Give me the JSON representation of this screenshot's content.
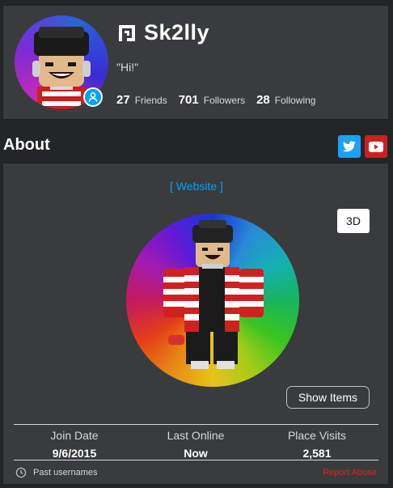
{
  "profile": {
    "username": "Sk2lly",
    "status": "\"Hi!\"",
    "friends_count": "27",
    "friends_label": "Friends",
    "followers_count": "701",
    "followers_label": "Followers",
    "following_count": "28",
    "following_label": "Following"
  },
  "about": {
    "title": "About",
    "website_label": "[ Website ]",
    "button_3d": "3D",
    "show_items": "Show Items",
    "stats": [
      {
        "label": "Join Date",
        "value": "9/6/2015"
      },
      {
        "label": "Last Online",
        "value": "Now"
      },
      {
        "label": "Place Visits",
        "value": "2,581"
      }
    ],
    "past_usernames": "Past usernames",
    "report_abuse": "Report Abuse"
  },
  "icons": {
    "premium": "premium-icon",
    "avatar_badge": "person-icon",
    "twitter": "twitter-icon",
    "youtube": "youtube-icon",
    "history": "clock-icon"
  },
  "colors": {
    "background": "#232527",
    "card": "#393b3d",
    "link": "#00a2ff",
    "twitter": "#1da1f2",
    "youtube": "#cc2121",
    "report": "#e2231a"
  }
}
